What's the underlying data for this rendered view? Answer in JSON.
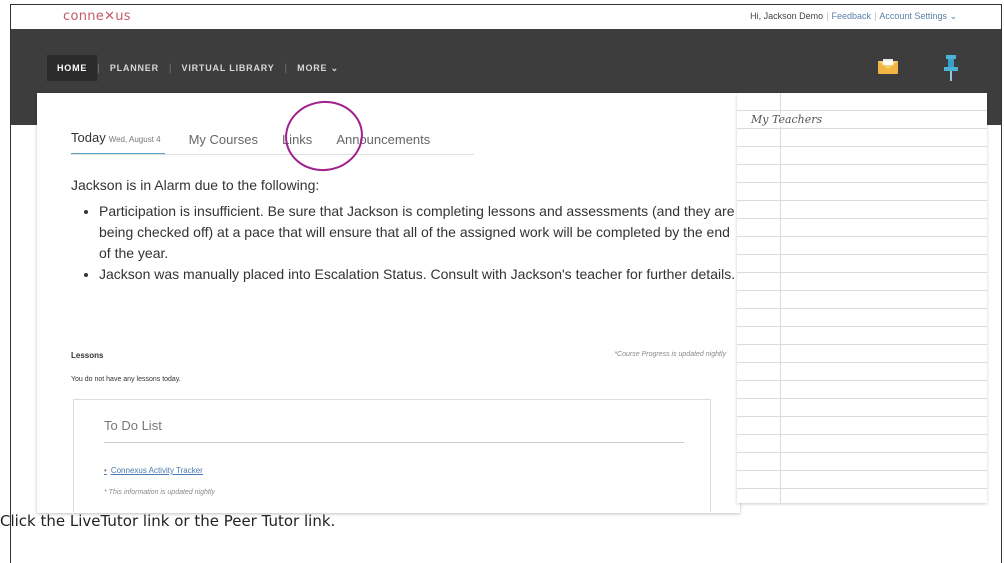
{
  "header": {
    "logo": "conne✕us",
    "greeting": "Hi, Jackson Demo",
    "feedback": "Feedback",
    "account_settings": "Account Settings ⌄"
  },
  "nav": {
    "items": [
      "HOME",
      "PLANNER",
      "VIRTUAL LIBRARY",
      "MORE ⌄"
    ],
    "active": "HOME"
  },
  "icons": {
    "mail": "mail-icon",
    "pin": "pushpin-icon"
  },
  "tabs": {
    "today": "Today",
    "today_date": "Wed, August 4",
    "my_courses": "My Courses",
    "links": "Links",
    "announcements": "Announcements"
  },
  "main": {
    "alarm_heading": "Jackson is in Alarm due to the following:",
    "reasons": [
      "Participation is insufficient. Be sure that Jackson is completing lessons and assessments (and they are being checked off) at a pace that will ensure that all of the assigned work will be completed by the end of the year.",
      "Jackson was manually placed into Escalation Status. Consult with Jackson's teacher for further details."
    ],
    "lessons_label": "Lessons",
    "progress_note": "*Course Progress is updated nightly",
    "no_lessons": "You do not have any lessons today."
  },
  "todo": {
    "title": "To Do List",
    "link": "Connexus Activity Tracker",
    "note": "* This information is updated nightly"
  },
  "sidebar": {
    "title": "My Teachers"
  },
  "caption": "Click the LiveTutor link or the Peer Tutor link.",
  "colors": {
    "navbar": "#3d3d3d",
    "accent": "#5aa5c5",
    "annotation_circle": "#a0208e",
    "link": "#4a78b0"
  }
}
